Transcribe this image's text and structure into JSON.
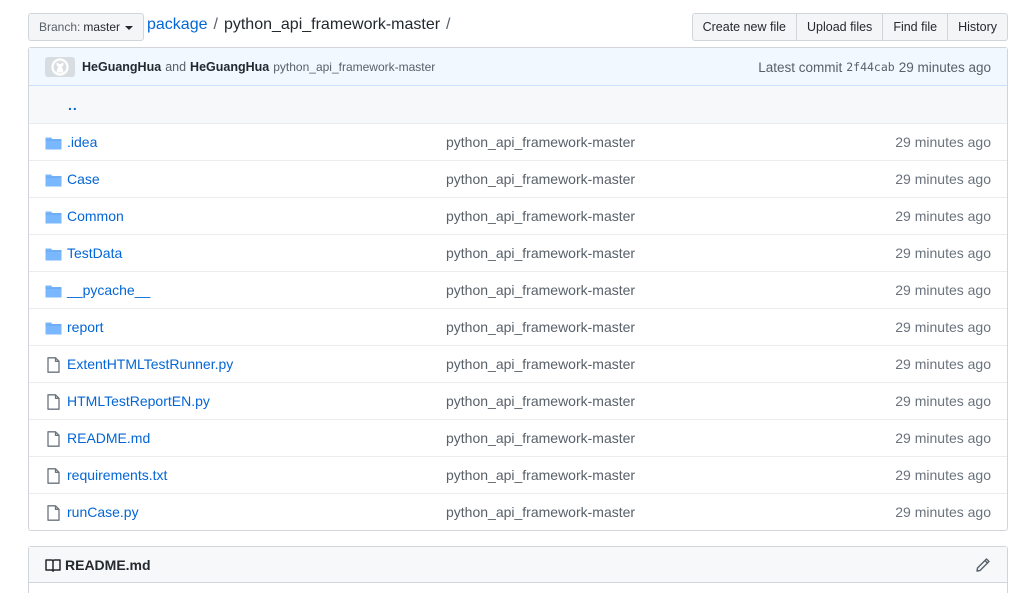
{
  "branch": {
    "label": "Branch:",
    "value": "master"
  },
  "breadcrumb": {
    "root": "package",
    "sep1": "/",
    "current": "python_api_framework-master",
    "sep2": "/"
  },
  "actions": {
    "create": "Create new file",
    "upload": "Upload files",
    "find": "Find file",
    "history": "History"
  },
  "commit": {
    "author1": "HeGuangHua",
    "and": "and",
    "author2": "HeGuangHua",
    "message": "python_api_framework-master",
    "latest_label": "Latest commit",
    "sha": "2f44cab",
    "time": "29 minutes ago"
  },
  "updir": "..",
  "files": [
    {
      "name": ".idea",
      "type": "folder",
      "message": "python_api_framework-master",
      "age": "29 minutes ago"
    },
    {
      "name": "Case",
      "type": "folder",
      "message": "python_api_framework-master",
      "age": "29 minutes ago"
    },
    {
      "name": "Common",
      "type": "folder",
      "message": "python_api_framework-master",
      "age": "29 minutes ago"
    },
    {
      "name": "TestData",
      "type": "folder",
      "message": "python_api_framework-master",
      "age": "29 minutes ago"
    },
    {
      "name": "__pycache__",
      "type": "folder",
      "message": "python_api_framework-master",
      "age": "29 minutes ago"
    },
    {
      "name": "report",
      "type": "folder",
      "message": "python_api_framework-master",
      "age": "29 minutes ago"
    },
    {
      "name": "ExtentHTMLTestRunner.py",
      "type": "file",
      "message": "python_api_framework-master",
      "age": "29 minutes ago"
    },
    {
      "name": "HTMLTestReportEN.py",
      "type": "file",
      "message": "python_api_framework-master",
      "age": "29 minutes ago"
    },
    {
      "name": "README.md",
      "type": "file",
      "message": "python_api_framework-master",
      "age": "29 minutes ago"
    },
    {
      "name": "requirements.txt",
      "type": "file",
      "message": "python_api_framework-master",
      "age": "29 minutes ago"
    },
    {
      "name": "runCase.py",
      "type": "file",
      "message": "python_api_framework-master",
      "age": "29 minutes ago"
    }
  ],
  "readme": {
    "title": "README.md"
  },
  "colors": {
    "link": "#0366d6",
    "folder_icon": "#79b8ff",
    "file_icon": "#6a737d",
    "commit_bg": "#f1f8ff"
  },
  "icons": {
    "folder": "folder-icon",
    "file": "file-icon",
    "book": "book-icon",
    "pencil": "pencil-icon",
    "caret": "caret-down-icon"
  }
}
